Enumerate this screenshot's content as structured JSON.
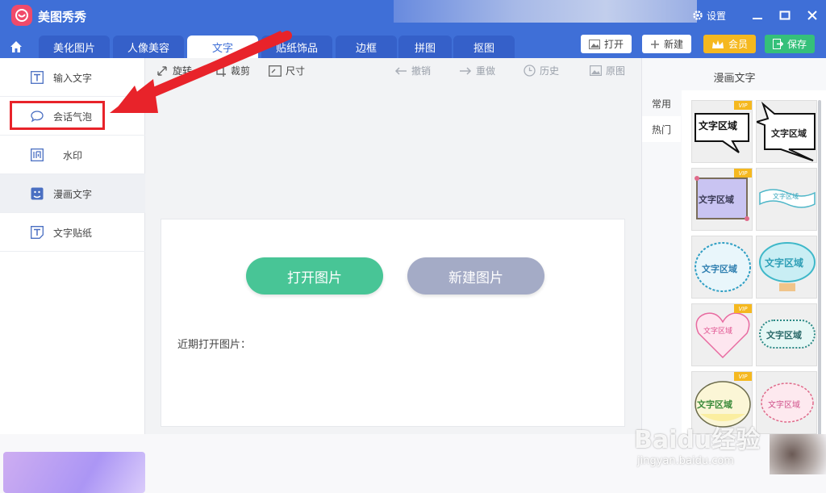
{
  "app": {
    "title": "美图秀秀",
    "settings": "设置"
  },
  "nav": {
    "tabs": [
      "美化图片",
      "人像美容",
      "文字",
      "贴纸饰品",
      "边框",
      "拼图",
      "抠图"
    ],
    "active": "文字",
    "actions": {
      "open": "打开",
      "new": "新建",
      "vip": "会员",
      "save": "保存"
    }
  },
  "sidebar": {
    "items": [
      {
        "label": "输入文字",
        "icon": "text-t-icon"
      },
      {
        "label": "会话气泡",
        "icon": "speech-bubble-icon"
      },
      {
        "label": "水印",
        "icon": "watermark-icon"
      },
      {
        "label": "漫画文字",
        "icon": "comic-text-icon"
      },
      {
        "label": "文字贴纸",
        "icon": "text-sticker-icon"
      }
    ]
  },
  "toolbar": {
    "rotate": "旋转",
    "crop": "裁剪",
    "size": "尺寸",
    "undo": "撤销",
    "redo": "重做",
    "history": "历史",
    "original": "原图"
  },
  "canvas": {
    "open_image": "打开图片",
    "new_image": "新建图片",
    "recent": "近期打开图片："
  },
  "panel": {
    "title": "漫画文字",
    "tabs": [
      "常用",
      "热门"
    ],
    "sticker_text": "文字区域",
    "vip_badge": "VIP"
  },
  "watermark": {
    "main": "Baidu经验",
    "sub": "jingyan.baidu.com"
  },
  "colors": {
    "brand": "#3f6fd7",
    "open": "#48c596",
    "new": "#a4abc6",
    "vip": "#f5b81f",
    "save": "#35c07a",
    "arrow": "#e8232a"
  }
}
